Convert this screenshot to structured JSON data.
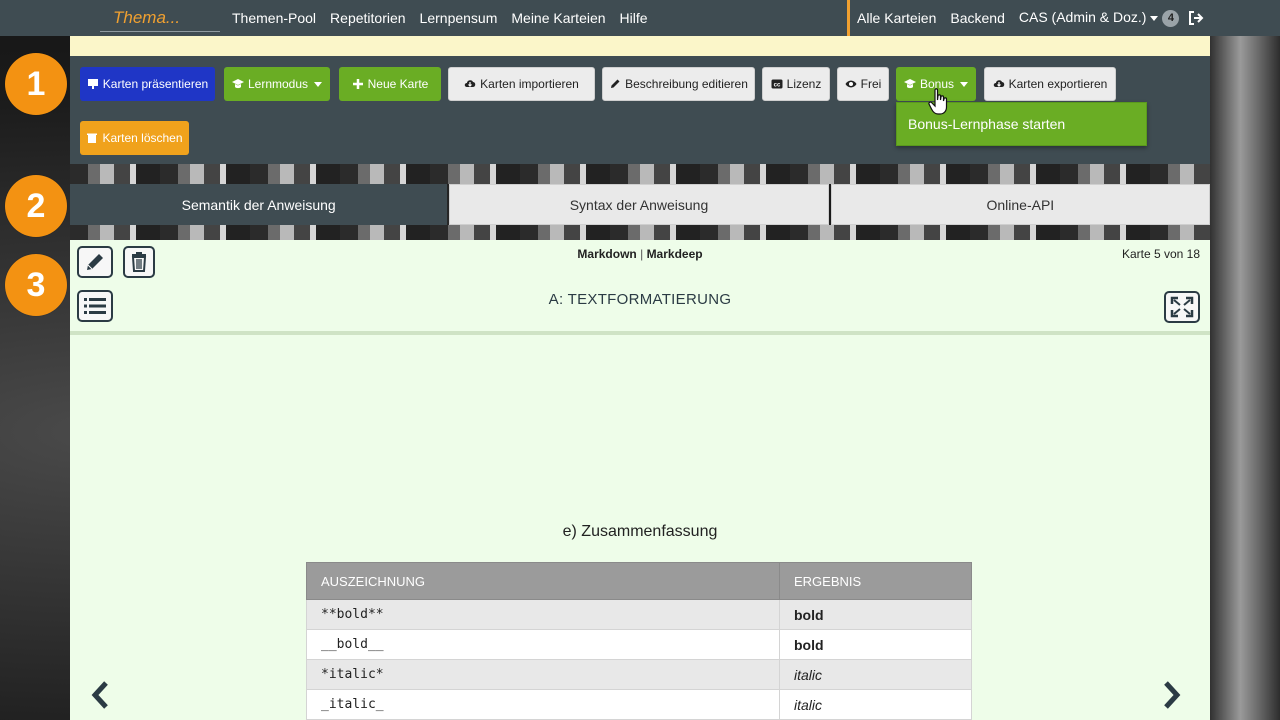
{
  "navbar": {
    "brand": "Thema...",
    "left_links": [
      "Themen-Pool",
      "Repetitorien",
      "Lernpensum",
      "Meine Karteien",
      "Hilfe"
    ],
    "right_links": {
      "all_decks": "Alle Karteien",
      "backend": "Backend",
      "user": "CAS (Admin & Doz.)",
      "badge": "4"
    }
  },
  "toolbar": {
    "present": "Karten präsentieren",
    "learn_mode": "Lernmodus",
    "new_card": "Neue Karte",
    "import": "Karten importieren",
    "edit_description": "Beschreibung editieren",
    "license": "Lizenz",
    "free": "Frei",
    "bonus": "Bonus",
    "export": "Karten exportieren",
    "delete": "Karten löschen",
    "bonus_menu_item": "Bonus-Lernphase starten"
  },
  "steps": [
    "1",
    "2",
    "3"
  ],
  "tabs": [
    {
      "label": "Semantik der Anweisung",
      "active": true
    },
    {
      "label": "Syntax der Anweisung",
      "active": false
    },
    {
      "label": "Online-API",
      "active": false
    }
  ],
  "card": {
    "format_primary": "Markdown",
    "format_separator": "|",
    "format_secondary": "Markdeep",
    "count": "Karte 5 von 18",
    "title": "A: TEXTFORMATIERUNG",
    "section_title": "e) Zusammenfassung",
    "table": {
      "headers": [
        "AUSZEICHNUNG",
        "ERGEBNIS"
      ],
      "rows": [
        {
          "markup": "**bold**",
          "result": "bold",
          "style": "bold"
        },
        {
          "markup": "__bold__",
          "result": "bold",
          "style": "bold"
        },
        {
          "markup": "*italic*",
          "result": "italic",
          "style": "italic"
        },
        {
          "markup": "_italic_",
          "result": "italic",
          "style": "italic"
        }
      ]
    }
  },
  "colors": {
    "navbar": "#3f4c52",
    "accent_orange": "#f39212",
    "primary_blue": "#1f36c6",
    "success_green": "#6aad24",
    "warning_orange": "#f0a21c",
    "card_bg": "#eefde9"
  },
  "icons": [
    "logout-icon",
    "presentation-icon",
    "graduation-cap-icon",
    "plus-icon",
    "cloud-download-icon",
    "pencil-icon",
    "cc-icon",
    "eye-icon",
    "trash-icon",
    "list-icon",
    "expand-icon",
    "chevron-left-icon",
    "chevron-right-icon",
    "hand-cursor-icon"
  ]
}
